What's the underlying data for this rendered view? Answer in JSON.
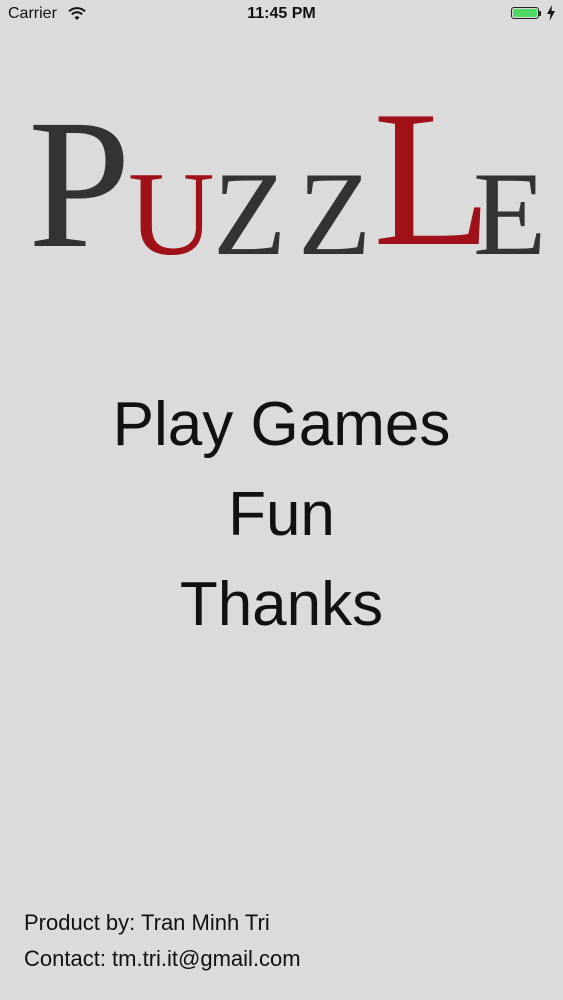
{
  "status_bar": {
    "carrier": "Carrier",
    "time": "11:45 PM",
    "battery_color": "#4cd964",
    "wifi_icon": "wifi-icon",
    "battery_icon": "battery-icon",
    "charging_icon": "charging-bolt-icon"
  },
  "logo": {
    "letters": [
      "P",
      "U",
      "Z",
      "Z",
      "L",
      "E"
    ],
    "dark_color": "#333333",
    "accent_color": "#a01018"
  },
  "main": {
    "lines": [
      "Play Games",
      "Fun",
      "Thanks"
    ]
  },
  "footer": {
    "product": "Product by: Tran Minh Tri",
    "contact": "Contact: tm.tri.it@gmail.com"
  }
}
